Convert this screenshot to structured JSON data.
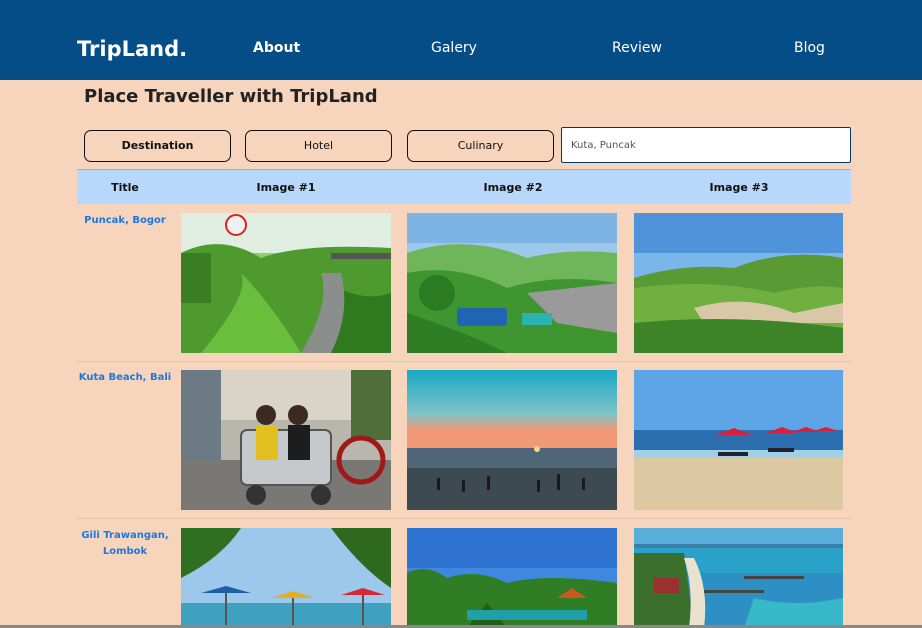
{
  "nav": {
    "brand": "TripLand.",
    "links": [
      "About",
      "Galery",
      "Review",
      "Blog"
    ]
  },
  "page": {
    "title": "Place Traveller with TripLand"
  },
  "filters": {
    "buttons": [
      "Destination",
      "Hotel",
      "Culinary"
    ],
    "search_placeholder": "Kuta, Puncak"
  },
  "table": {
    "headers": [
      "Title",
      "Image #1",
      "Image #2",
      "Image #3"
    ],
    "rows": [
      {
        "title": "Puncak, Bogor"
      },
      {
        "title": "Kuta Beach, Bali"
      },
      {
        "title": "Gili Trawangan, Lombok"
      }
    ]
  },
  "colors": {
    "navbar": "#054d86",
    "background": "#f7d5bd",
    "table_header": "#b8d8fb",
    "link": "#1a78e0"
  }
}
